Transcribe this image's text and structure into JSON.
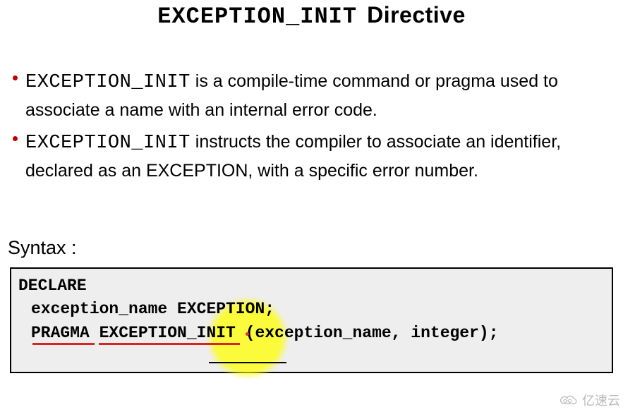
{
  "title": {
    "code_part": "EXCEPTION_INIT",
    "text_part": "Directive"
  },
  "bullets": [
    {
      "code": "EXCEPTION_INIT",
      "rest": " is a compile-time command or pragma used to associate a name with an internal error code."
    },
    {
      "code": "EXCEPTION_INIT",
      "rest": " instructs the compiler to associate an identifier, declared as an EXCEPTION,  with a specific error number."
    }
  ],
  "syntax_label": "Syntax :",
  "code": {
    "line1": "DECLARE",
    "line2": "exception_name EXCEPTION;",
    "line3": "PRAGMA EXCEPTION_INIT (exception_name, integer);"
  },
  "watermark_text": "亿速云"
}
